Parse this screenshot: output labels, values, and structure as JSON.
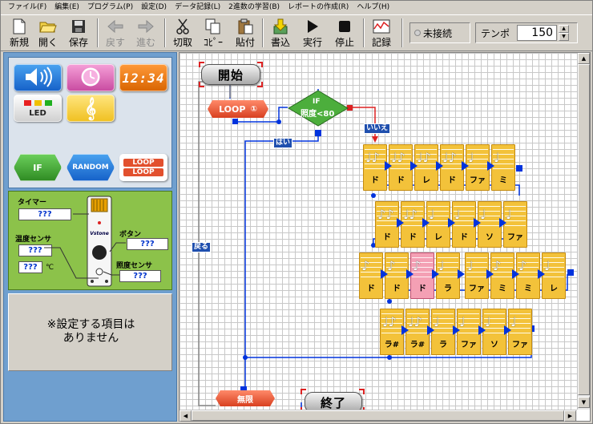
{
  "menu": [
    "ファイル(F)",
    "編集(E)",
    "プログラム(P)",
    "設定(D)",
    "データ記録(L)",
    "2進数の学習(B)",
    "レポートの作成(R)",
    "ヘルプ(H)"
  ],
  "toolbar": {
    "new": "新規",
    "open": "開く",
    "save": "保存",
    "back": "戻す",
    "forward": "進む",
    "cut": "切取",
    "copy": "ｺﾋﾟｰ",
    "paste": "貼付",
    "write": "書込",
    "run": "実行",
    "stop": "停止",
    "record": "記録"
  },
  "status": {
    "connection": "未接続",
    "tempo_label": "テンポ",
    "tempo_value": "150"
  },
  "palette": {
    "led_label": "LED",
    "if_label": "IF",
    "random_label": "RANDOM",
    "loop_label_top": "LOOP",
    "loop_label_bottom": "LOOP",
    "clock_display": "12:34"
  },
  "sensors": {
    "timer_label": "タイマー",
    "timer_value": "???",
    "temp_label": "温度センサ",
    "temp_value1": "???",
    "temp_value2": "???",
    "temp_unit": "℃",
    "button_label": "ボタン",
    "button_value": "???",
    "light_label": "照度センサ",
    "light_value": "???",
    "robot_brand": "Vstone"
  },
  "info": {
    "message": "※設定する項目は\nありません"
  },
  "flow": {
    "start": "開始",
    "end": "終了",
    "loop_label": "LOOP",
    "loop_count": "①",
    "if_top": "IF",
    "if_condition": "照度<80",
    "yes_label": "はい",
    "no_label": "いいえ",
    "back_label": "戻る",
    "infinite_label": "無限"
  },
  "notes": {
    "row1": [
      "ド",
      "ド",
      "レ",
      "ド",
      "ファ",
      "ミ"
    ],
    "row2": [
      "ド",
      "ド",
      "レ",
      "ド",
      "ソ",
      "ファ"
    ],
    "row3": [
      "ド",
      "ド",
      "ド",
      "ラ",
      "ファ",
      "ミ",
      "ミ",
      "レ"
    ],
    "row4": [
      "ラ#",
      "ラ#",
      "ラ",
      "ファ",
      "ソ",
      "ファ"
    ],
    "highlighted": "row3.2",
    "icons": {
      "row1": [
        "♩♪",
        "♩♪",
        "♩♪",
        "♩♪",
        "♩",
        "♩"
      ],
      "row2": [
        "♪♪",
        "♩♪",
        "♩",
        "♩",
        "♩",
        "♩"
      ],
      "row3": [
        "♪",
        "♪",
        "♪",
        "♩",
        "♩",
        "♪",
        "♪",
        "♩"
      ],
      "row4": [
        "♩♪",
        "♩♪",
        "♩",
        "♩",
        "♩",
        "♩"
      ]
    }
  },
  "colors": {
    "accent_blue": "#0033dd",
    "note_yellow": "#f3c23a",
    "note_pink": "#f4a0b4",
    "loop_red": "#e2502e",
    "if_green": "#4cae3c",
    "sensor_green": "#8cc24a",
    "panel_blue": "#6f9fcf"
  }
}
